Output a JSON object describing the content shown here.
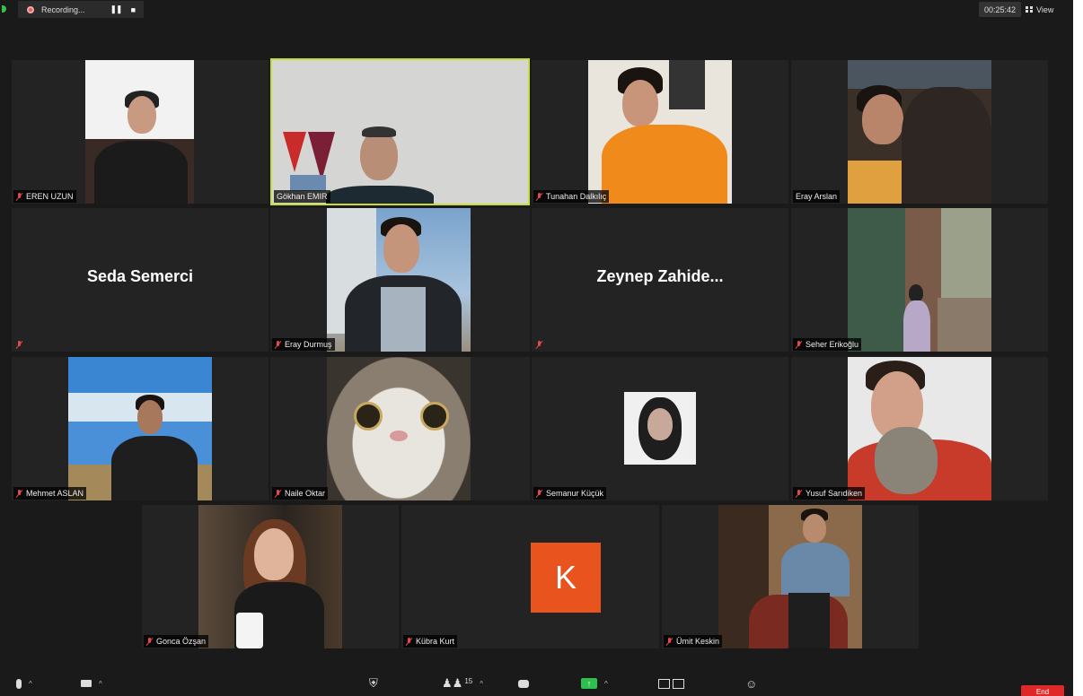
{
  "topbar": {
    "recording_label": "Recording...",
    "timer": "00:25:42",
    "view_label": "View"
  },
  "participants": [
    {
      "name": "EREN UZUN",
      "muted": true
    },
    {
      "name": "Gökhan EMIR",
      "muted": false,
      "active_speaker": true
    },
    {
      "name": "Tunahan Dalkılıç",
      "muted": true
    },
    {
      "name": "Eray Arslan",
      "muted": false
    },
    {
      "name": "Seda Semerci",
      "muted": true,
      "video_off": true
    },
    {
      "name": "Eray Durmuş",
      "muted": true
    },
    {
      "name": "Zeynep  Zahide...",
      "muted": true,
      "video_off": true
    },
    {
      "name": "Seher Erikoğlu",
      "muted": true
    },
    {
      "name": "Mehmet ASLAN",
      "muted": true
    },
    {
      "name": "Naile Oktar",
      "muted": true
    },
    {
      "name": "Semanur Küçük",
      "muted": true
    },
    {
      "name": "Yusuf Sarıdiken",
      "muted": true
    },
    {
      "name": "Gonca Özşan",
      "muted": true
    },
    {
      "name": "Kübra Kurt",
      "muted": true,
      "avatar_letter": "K"
    },
    {
      "name": "Ümit Keskin",
      "muted": true
    }
  ],
  "toolbar": {
    "participants_count": "15",
    "end_label": "End"
  },
  "colors": {
    "active_border": "#c8dc3c",
    "avatar_bg": "#e8531e",
    "end_button": "#e02828",
    "share_green": "#2fbf4f"
  }
}
